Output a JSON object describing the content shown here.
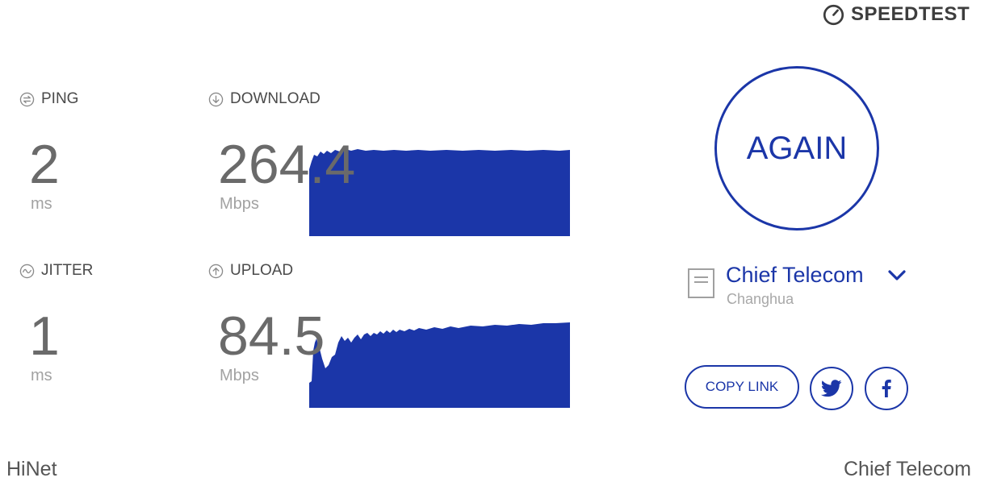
{
  "brand": {
    "name": "SPEEDTEST",
    "icon": "speedometer-icon"
  },
  "metrics": {
    "ping": {
      "label": "PING",
      "icon": "ping-icon",
      "value": "2",
      "unit": "ms"
    },
    "jitter": {
      "label": "JITTER",
      "icon": "jitter-icon",
      "value": "1",
      "unit": "ms"
    },
    "download": {
      "label": "DOWNLOAD",
      "icon": "download-icon",
      "value": "264.4",
      "unit": "Mbps"
    },
    "upload": {
      "label": "UPLOAD",
      "icon": "upload-icon",
      "value": "84.5",
      "unit": "Mbps"
    }
  },
  "actions": {
    "again_label": "AGAIN",
    "copy_link_label": "COPY LINK",
    "share_icons": [
      "twitter-icon",
      "facebook-icon"
    ]
  },
  "server": {
    "name": "Chief Telecom",
    "location": "Changhua",
    "icon": "server-icon"
  },
  "footer": {
    "isp": "HiNet",
    "server": "Chief Telecom"
  },
  "colors": {
    "accent": "#1b36a8",
    "graph_fill": "#1b36a8",
    "value_text": "#6a6a6a",
    "unit_text": "#a2a2a2"
  }
}
